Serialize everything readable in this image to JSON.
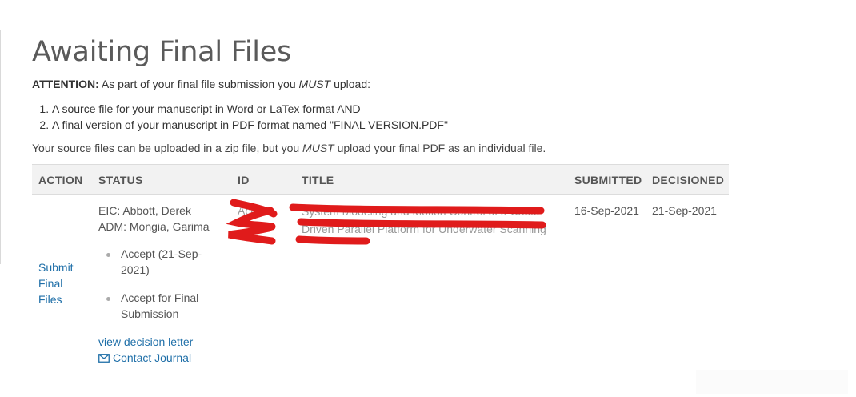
{
  "page": {
    "title": "Awaiting Final Files",
    "attention_label": "ATTENTION:",
    "attention_pre": " As part of your final file submission you ",
    "attention_em": "MUST",
    "attention_post": " upload:",
    "requirements": [
      "A source file for your manuscript in Word or LaTex format AND",
      "A final version of your manuscript in PDF format named \"FINAL VERSION.PDF\""
    ],
    "note_pre": "Your source files can be uploaded in a zip file, but you ",
    "note_em": "MUST",
    "note_post": " upload your final PDF as an individual file."
  },
  "table": {
    "headers": {
      "action": "ACTION",
      "status": "STATUS",
      "id": "ID",
      "title": "TITLE",
      "submitted": "SUBMITTED",
      "decisioned": "DECISIONED"
    },
    "row": {
      "action_label": "Submit Final Files",
      "status_eic": "EIC: Abbott, Derek",
      "status_adm": "ADM: Mongia, Garima",
      "decisions": [
        "Accept (21-Sep-2021)",
        "Accept for Final Submission"
      ],
      "view_letter": "view decision letter",
      "contact_journal": "Contact Journal",
      "id_partial": "Acc",
      "title_partial_line1": "System Modeling and Motion Control of a Cable-",
      "title_partial_line2": "Driven Parallel Platform for Underwater Scanning",
      "submitted": "16-Sep-2021",
      "decisioned": "21-Sep-2021"
    }
  },
  "icons": {
    "contact": "envelope-icon"
  },
  "colors": {
    "link": "#1f6fa8",
    "redaction": "#e01b1b"
  }
}
